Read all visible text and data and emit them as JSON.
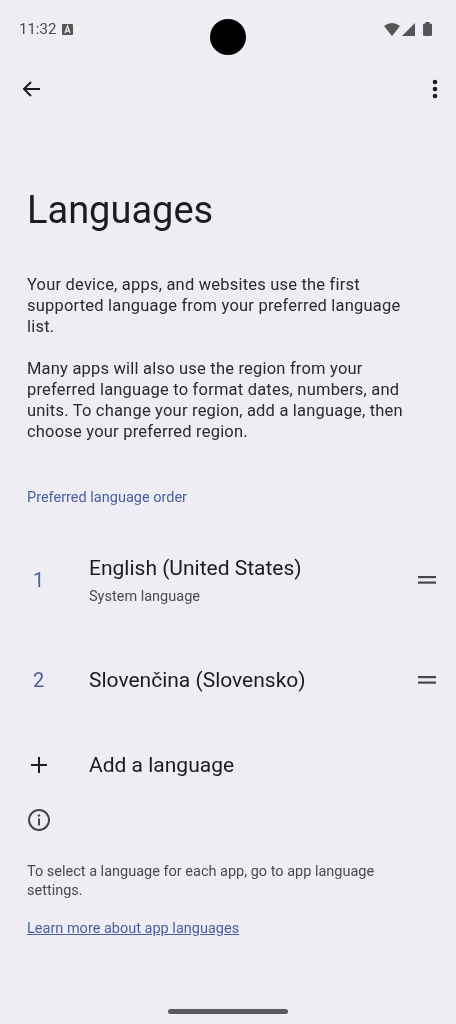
{
  "status_bar": {
    "time": "11:32"
  },
  "title": "Languages",
  "description": [
    "Your device, apps, and websites use the first supported language from your preferred language list.",
    "Many apps will also use the region from your preferred language to format dates, numbers, and units. To change your region, add a language, then choose your preferred region."
  ],
  "section_header": "Preferred language order",
  "languages": [
    {
      "number": "1",
      "name": "English (United States)",
      "subtitle": "System language"
    },
    {
      "number": "2",
      "name": "Slovenčina (Slovensko)"
    }
  ],
  "add_language": "Add a language",
  "footer": {
    "text": "To select a language for each app, go to app language settings.",
    "link": "Learn more about app languages"
  }
}
